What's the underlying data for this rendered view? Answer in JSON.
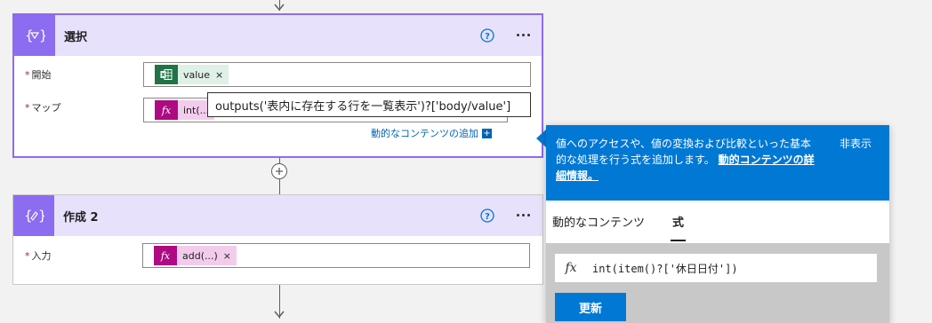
{
  "colors": {
    "action_purple": "#8c6cf0",
    "header_bg": "#e8e1fc",
    "excel_green": "#217346",
    "expression_magenta": "#ae0b83",
    "token_bg": "#f3ccec",
    "value_token_bg": "#dff0e6",
    "link_blue": "#0063b1",
    "primary_blue": "#0078d4"
  },
  "select_card": {
    "title": "選択",
    "icon": "select-braces-icon",
    "fields": {
      "from_label": "開始",
      "from_token": "value",
      "map_label": "マップ",
      "map_token": "int(...",
      "required_mark": "*"
    },
    "tooltip": "outputs('表内に存在する行を一覧表示')?['body/value']",
    "dynamic_link": "動的なコンテンツの追加",
    "token_close": "×"
  },
  "compose_card": {
    "title": "作成 2",
    "icon": "compose-braces-icon",
    "input_label": "入力",
    "input_token": "add(...)",
    "required_mark": "*",
    "token_close": "×"
  },
  "panel": {
    "banner_text": "値へのアクセスや、値の変換および比較といった基本的な処理を行う式を追加します。",
    "banner_link": "動的コンテンツの詳細情報。",
    "hide_label": "非表示",
    "tabs": [
      "動的なコンテンツ",
      "式"
    ],
    "active_tab": "式",
    "fx_label": "fx",
    "expression": "int(item()?['休日日付'])",
    "update_button": "更新"
  }
}
